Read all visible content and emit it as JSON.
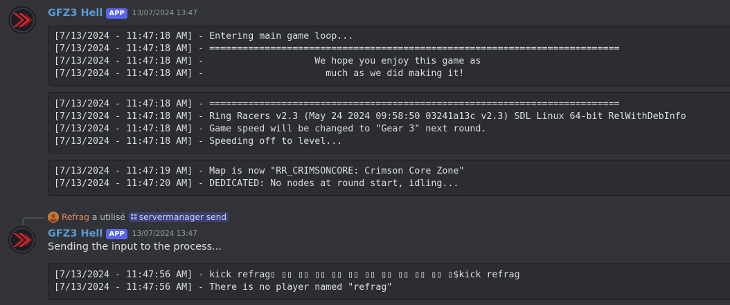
{
  "colors": {
    "background": "#313338",
    "codeblock_bg": "#2b2d31",
    "username": "#5b9bd5",
    "badge": "#5865f2",
    "timestamp": "#949ba4",
    "reply_user": "#e0895a"
  },
  "message1": {
    "avatar_icon": "red-chevron-logo",
    "username": "GFZ3 Hell",
    "badge": "APP",
    "timestamp": "13/07/2024 13:47",
    "blocks": [
      {
        "lines": [
          "[7/13/2024 - 11:47:18 AM] - Entering main game loop...",
          "[7/13/2024 - 11:47:18 AM] - ==========================================================================",
          "[7/13/2024 - 11:47:18 AM] -                    We hope you enjoy this game as",
          "[7/13/2024 - 11:47:18 AM] -                      much as we did making it!"
        ]
      },
      {
        "lines": [
          "[7/13/2024 - 11:47:18 AM] - ==========================================================================",
          "[7/13/2024 - 11:47:18 AM] - Ring Racers v2.3 (May 24 2024 09:58:50 03241a13c v2.3) SDL Linux 64-bit RelWithDebInfo",
          "[7/13/2024 - 11:47:18 AM] - Game speed will be changed to \"Gear 3\" next round.",
          "[7/13/2024 - 11:47:18 AM] - Speeding off to level..."
        ]
      },
      {
        "lines": [
          "[7/13/2024 - 11:47:19 AM] - Map is now \"RR_CRIMSONCORE: Crimson Core Zone\"",
          "[7/13/2024 - 11:47:20 AM] - DEDICATED: No nodes at round start, idling..."
        ]
      }
    ]
  },
  "reply": {
    "user": "Refrag",
    "verb": "a utilisé",
    "command_icon": "slash-command-icon",
    "command": "servermanager send"
  },
  "message2": {
    "avatar_icon": "red-chevron-logo",
    "username": "GFZ3 Hell",
    "badge": "APP",
    "timestamp": "13/07/2024 13:47",
    "content": "Sending the input to the process...",
    "blocks": [
      {
        "lines": [
          "[7/13/2024 - 11:47:56 AM] - kick refrag▯ ▯▯ ▯▯ ▯▯ ▯▯ ▯▯ ▯▯ ▯▯ ▯▯ ▯▯ ▯▯ ▯$kick refrag",
          "[7/13/2024 - 11:47:56 AM] - There is no player named \"refrag\""
        ]
      }
    ]
  }
}
